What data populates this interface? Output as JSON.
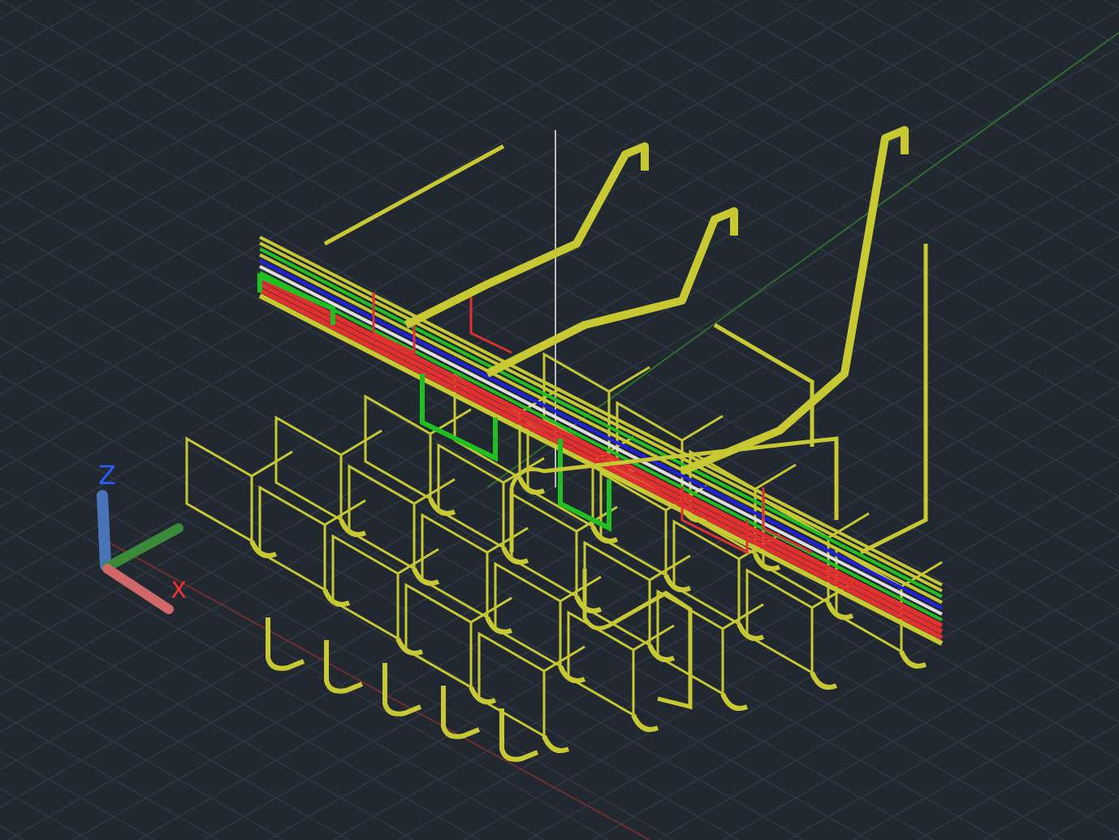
{
  "viewport": {
    "axis_labels": [
      {
        "kind": "z",
        "text": "Z"
      },
      {
        "kind": "x",
        "text": "X"
      }
    ]
  }
}
